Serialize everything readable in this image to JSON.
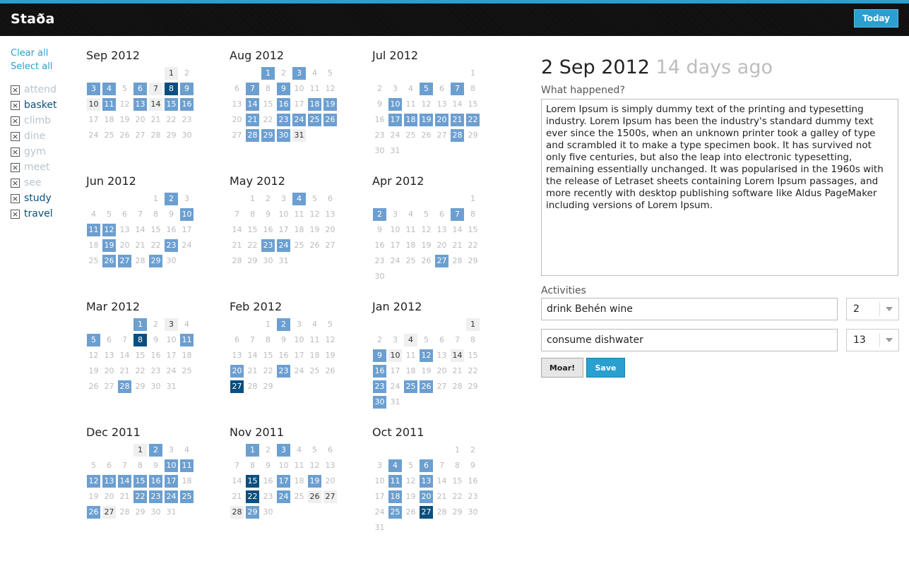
{
  "app": {
    "brand": "Staða",
    "today_label": "Today"
  },
  "sidebar": {
    "clear_all": "Clear all",
    "select_all": "Select all",
    "tags": [
      {
        "label": "attend",
        "checked": false
      },
      {
        "label": "basket",
        "checked": true
      },
      {
        "label": "climb",
        "checked": false
      },
      {
        "label": "dine",
        "checked": false
      },
      {
        "label": "gym",
        "checked": false
      },
      {
        "label": "meet",
        "checked": false
      },
      {
        "label": "see",
        "checked": false
      },
      {
        "label": "study",
        "checked": true
      },
      {
        "label": "travel",
        "checked": true
      }
    ],
    "checkbox_glyph": "×"
  },
  "colors": {
    "accent": "#2a9fd0",
    "event": "#6c9fd0",
    "event_strong": "#0b4f7f",
    "marked": "#efefef"
  },
  "calendar": {
    "months": [
      {
        "title": "Sep 2012",
        "lead": 5,
        "days": 30,
        "e1": [
          3,
          4,
          6,
          9,
          11,
          13,
          15,
          16
        ],
        "e2": [
          8
        ],
        "mk": [
          1,
          7,
          10,
          14
        ]
      },
      {
        "title": "Aug 2012",
        "lead": 2,
        "days": 31,
        "e1": [
          1,
          3,
          7,
          9,
          14,
          16,
          18,
          19,
          21,
          23,
          24,
          25,
          26,
          28,
          29,
          30
        ],
        "e2": [],
        "mk": [
          31
        ]
      },
      {
        "title": "Jul 2012",
        "lead": 6,
        "days": 31,
        "e1": [
          5,
          7,
          10,
          17,
          18,
          19,
          20,
          21,
          22,
          28
        ],
        "e2": [],
        "mk": []
      },
      {
        "title": "Jun 2012",
        "lead": 4,
        "days": 30,
        "e1": [
          2,
          10,
          11,
          12,
          19,
          23,
          26,
          27,
          29
        ],
        "e2": [],
        "mk": []
      },
      {
        "title": "May 2012",
        "lead": 1,
        "days": 31,
        "e1": [
          4,
          23,
          24
        ],
        "e2": [],
        "mk": []
      },
      {
        "title": "Apr 2012",
        "lead": 6,
        "days": 30,
        "e1": [
          2,
          7,
          27
        ],
        "e2": [],
        "mk": []
      },
      {
        "title": "Mar 2012",
        "lead": 3,
        "days": 31,
        "e1": [
          1,
          5,
          11,
          28
        ],
        "e2": [
          8
        ],
        "mk": [
          3
        ]
      },
      {
        "title": "Feb 2012",
        "lead": 2,
        "days": 29,
        "e1": [
          2,
          20,
          23
        ],
        "e2": [
          27
        ],
        "mk": []
      },
      {
        "title": "Jan 2012",
        "lead": 6,
        "days": 31,
        "e1": [
          9,
          12,
          16,
          23,
          25,
          26,
          30
        ],
        "e2": [],
        "mk": [
          1,
          4,
          10,
          14
        ]
      },
      {
        "title": "Dec 2011",
        "lead": 3,
        "days": 31,
        "e1": [
          2,
          10,
          11,
          12,
          13,
          14,
          15,
          16,
          17,
          22,
          23,
          24,
          25,
          26
        ],
        "e2": [],
        "mk": [
          1,
          27
        ]
      },
      {
        "title": "Nov 2011",
        "lead": 1,
        "days": 30,
        "e1": [
          1,
          3,
          17,
          19,
          24,
          29
        ],
        "e2": [
          15,
          22
        ],
        "mk": [
          26,
          27,
          28
        ]
      },
      {
        "title": "Oct 2011",
        "lead": 5,
        "days": 31,
        "e1": [
          4,
          6,
          11,
          13,
          18,
          20,
          25
        ],
        "e2": [
          27
        ],
        "mk": []
      }
    ]
  },
  "detail": {
    "date": "2 Sep 2012",
    "ago": "14 days ago",
    "what_label": "What happened?",
    "story": "Lorem Ipsum is simply dummy text of the printing and typesetting industry. Lorem Ipsum has been the industry's standard dummy text ever since the 1500s, when an unknown printer took a galley of type and scrambled it to make a type specimen book. It has survived not only five centuries, but also the leap into electronic typesetting, remaining essentially unchanged. It was popularised in the 1960s with the release of Letraset sheets containing Lorem Ipsum passages, and more recently with desktop publishing software like Aldus PageMaker including versions of Lorem Ipsum.",
    "activities_label": "Activities",
    "activities": [
      {
        "name": "drink Behén wine",
        "amount": "2"
      },
      {
        "name": "consume dishwater",
        "amount": "13"
      }
    ],
    "moar_label": "Moar!",
    "save_label": "Save"
  }
}
